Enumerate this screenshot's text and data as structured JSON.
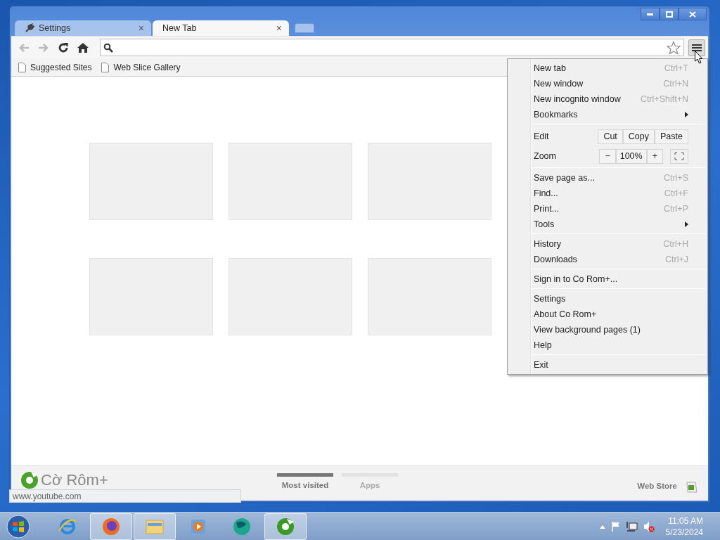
{
  "window": {
    "tabs": [
      {
        "label": "Settings",
        "kind": "with_icon",
        "close": "×",
        "selected": false
      },
      {
        "label": "New Tab",
        "kind": "plain",
        "close": "×",
        "selected": true
      }
    ]
  },
  "bookmarks": [
    "Suggested Sites",
    "Web Slice Gallery"
  ],
  "tiles": [
    {
      "kind": "empty"
    },
    {
      "kind": "empty"
    },
    {
      "kind": "empty"
    },
    {
      "kind": "empty"
    },
    {
      "kind": "empty"
    },
    {
      "kind": "empty"
    }
  ],
  "footer": {
    "logo": "Cờ Rôm+",
    "tabs": [
      {
        "label": "Most visited",
        "selected": true
      },
      {
        "label": "Apps",
        "selected": false
      }
    ],
    "web_store": "Web Store"
  },
  "status_bubble": "www.youtube.com",
  "menu": {
    "sections": [
      [
        {
          "kind": "item",
          "label": "New tab",
          "shortcut": "Ctrl+T"
        },
        {
          "kind": "item",
          "label": "New window",
          "shortcut": "Ctrl+N"
        },
        {
          "kind": "item",
          "label": "New incognito window",
          "shortcut": "Ctrl+Shift+N"
        },
        {
          "kind": "submenu",
          "label": "Bookmarks"
        }
      ],
      [
        {
          "kind": "edit",
          "label": "Edit",
          "buttons": [
            "Cut",
            "Copy",
            "Paste"
          ]
        },
        {
          "kind": "zoom",
          "label": "Zoom",
          "minus": "−",
          "value": "100%",
          "plus": "+"
        }
      ],
      [
        {
          "kind": "item",
          "label": "Save page as...",
          "shortcut": "Ctrl+S"
        },
        {
          "kind": "item",
          "label": "Find...",
          "shortcut": "Ctrl+F"
        },
        {
          "kind": "item",
          "label": "Print...",
          "shortcut": "Ctrl+P"
        },
        {
          "kind": "submenu",
          "label": "Tools"
        }
      ],
      [
        {
          "kind": "item",
          "label": "History",
          "shortcut": "Ctrl+H"
        },
        {
          "kind": "item",
          "label": "Downloads",
          "shortcut": "Ctrl+J"
        }
      ],
      [
        {
          "kind": "item",
          "label": "Sign in to Co Rom+..."
        }
      ],
      [
        {
          "kind": "item",
          "label": "Settings"
        },
        {
          "kind": "item",
          "label": "About Co Rom+"
        },
        {
          "kind": "item",
          "label": "View background pages (1)"
        },
        {
          "kind": "item",
          "label": "Help"
        }
      ],
      [
        {
          "kind": "item",
          "label": "Exit"
        }
      ]
    ]
  },
  "taskbar": {
    "apps": [
      {
        "kind": "ie",
        "active": false
      },
      {
        "kind": "firefox",
        "active": true
      },
      {
        "kind": "explorer",
        "active": true
      },
      {
        "kind": "media",
        "active": false
      },
      {
        "kind": "globe",
        "active": false
      },
      {
        "kind": "corom",
        "active": true
      }
    ],
    "time": "11:05 AM",
    "date": "5/23/2024"
  }
}
